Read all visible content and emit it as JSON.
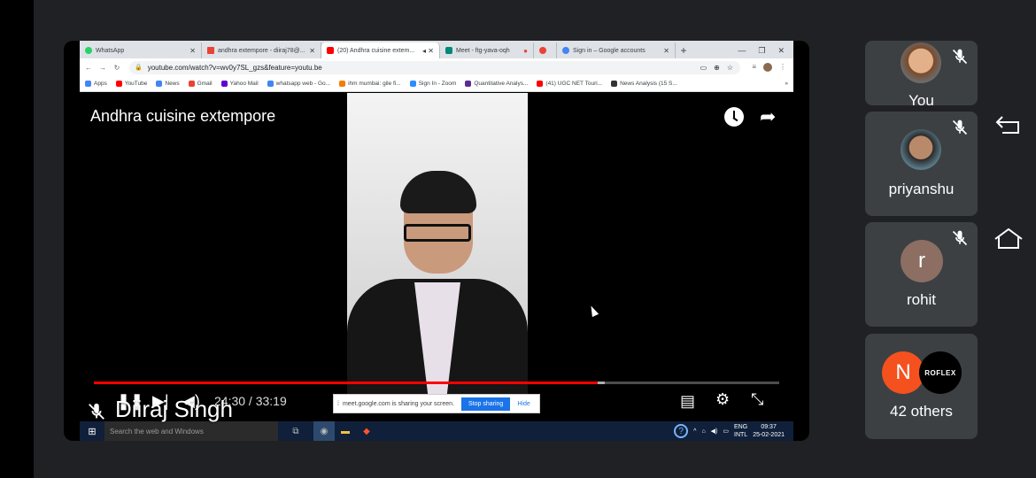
{
  "browser": {
    "tabs": [
      {
        "label": "WhatsApp",
        "color": "#25d366",
        "active": false
      },
      {
        "label": "andhra extempore - diiraj78@...",
        "color": "#ea4335",
        "active": false
      },
      {
        "label": "(20) Andhra cuisine extem...",
        "color": "#ff0000",
        "active": true
      },
      {
        "label": "Meet - ftg-yava-oqh",
        "color": "#00897b",
        "active": false
      },
      {
        "label": "",
        "color": "#ea4335",
        "active": false
      },
      {
        "label": "Sign in – Google accounts",
        "color": "#4285f4",
        "active": false
      }
    ],
    "url": "youtube.com/watch?v=wv0y7SL_gzs&feature=youtu.be",
    "bookmarks": [
      {
        "label": "Apps",
        "color": "#4285f4"
      },
      {
        "label": "YouTube",
        "color": "#ff0000"
      },
      {
        "label": "News",
        "color": "#4285f4"
      },
      {
        "label": "Gmail",
        "color": "#ea4335"
      },
      {
        "label": "Yahoo Mail",
        "color": "#6001d2"
      },
      {
        "label": "whatsapp web - Go...",
        "color": "#4285f4"
      },
      {
        "label": "ihm mumbai: gile fi...",
        "color": "#f57c00"
      },
      {
        "label": "Sign In - Zoom",
        "color": "#2d8cff"
      },
      {
        "label": "Quantitative Analys...",
        "color": "#5c2d91"
      },
      {
        "label": "(41) UGC NET Touri...",
        "color": "#ff0000"
      },
      {
        "label": "News Analysis (15 S...",
        "color": "#333333"
      }
    ]
  },
  "video": {
    "title": "Andhra cuisine extempore",
    "current_time": "24:30",
    "duration": "33:19",
    "progress_fraction": 0.735,
    "buffer_fraction": 0.745
  },
  "share_notice": {
    "text": "meet.google.com is sharing your screen.",
    "stop_label": "Stop sharing",
    "hide_label": "Hide"
  },
  "taskbar": {
    "search_placeholder": "Search the web and Windows",
    "lang_top": "ENG",
    "lang_bottom": "INTL",
    "time": "09:37",
    "date": "25-02-2021"
  },
  "presenter": {
    "name": "Diiraj Singh"
  },
  "participants": [
    {
      "name": "You",
      "muted": true
    },
    {
      "name": "priyanshu",
      "muted": true
    },
    {
      "name": "rohit",
      "initial": "r",
      "avatar_color": "#8d6e63",
      "muted": true
    },
    {
      "name": "42 others",
      "initial": "N",
      "avatar_color": "#f4511e",
      "logo_text": "ROFLEX"
    }
  ]
}
